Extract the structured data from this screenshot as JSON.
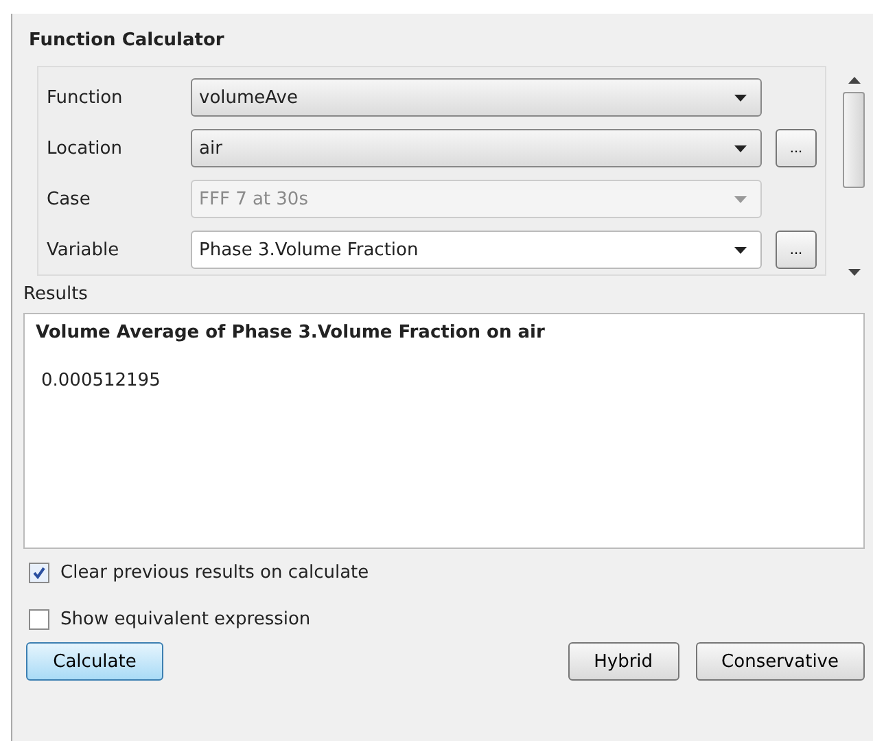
{
  "panel": {
    "title": "Function Calculator"
  },
  "fields": [
    {
      "label": "Function",
      "kind": "combo",
      "value": "volumeAve",
      "disabled": false
    },
    {
      "label": "Location",
      "kind": "combo",
      "value": "air",
      "disabled": false,
      "browse": "..."
    },
    {
      "label": "Case",
      "kind": "combo",
      "value": "FFF 7 at 30s",
      "disabled": true
    },
    {
      "label": "Variable",
      "kind": "editable",
      "value": "Phase 3.Volume Fraction",
      "disabled": false,
      "browse": "..."
    }
  ],
  "results": {
    "label": "Results",
    "heading": "Volume Average of Phase 3.Volume Fraction on air",
    "value": "0.000512195"
  },
  "options": [
    {
      "label": "Clear previous results on calculate",
      "checked": true
    },
    {
      "label": "Show equivalent expression",
      "checked": false
    }
  ],
  "buttons": [
    {
      "label": "Calculate",
      "default": true
    },
    {
      "label": "Hybrid",
      "default": false
    },
    {
      "label": "Conservative",
      "default": false
    }
  ]
}
